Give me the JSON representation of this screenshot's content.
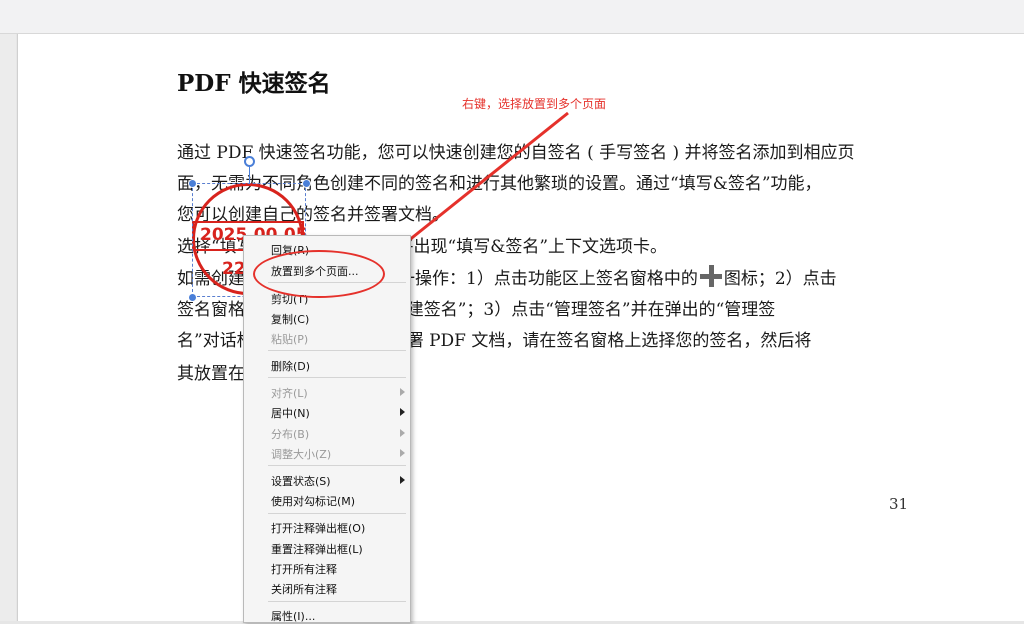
{
  "doc": {
    "title": "PDF 快速签名",
    "para1": "通过 PDF 快速签名功能，您可以快速创建您的自签名 ( 手写签名 ) 并将签名添加到相应页",
    "para2": "面，无需为不同角色创建不同的签名和进行其他繁琐的设置。通过“填写&签名”功能，",
    "para3": "您可以创建自己的签名并签署文档。",
    "para4": "选择“填写&签名”。功能区上将出现“填写&签名”上下文选项卡。",
    "para5a": "如需创建签名，请执行以下任一操作：1）点击功能区上签名窗格中的",
    "para5b": "图标；2）点击",
    "para6": "签名窗格中的签名框并选择“创建签名”；3）点击“管理签名”并在弹出的“管理签",
    "para7": "名”对话框中点击添加。如需签署 PDF 文档，请在签名窗格上选择您的签名，然后将",
    "para8": "其放置在所需位置并签名即可。",
    "page_number": "31"
  },
  "annotation": {
    "text": "右键，选择放置到多个页面",
    "color": "#e5312b"
  },
  "stamp": {
    "date": "2025.00.05",
    "sub": "22",
    "color": "#d8231d"
  },
  "context_menu": {
    "items": [
      {
        "label": "回复(R)",
        "enabled": true
      },
      {
        "label": "放置到多个页面...",
        "enabled": true
      },
      {
        "label": "剪切(T)",
        "enabled": true
      },
      {
        "label": "复制(C)",
        "enabled": true
      },
      {
        "label": "粘贴(P)",
        "enabled": false
      },
      {
        "label": "删除(D)",
        "enabled": true
      },
      {
        "label": "对齐(L)",
        "enabled": false
      },
      {
        "label": "居中(N)",
        "enabled": true
      },
      {
        "label": "分布(B)",
        "enabled": false
      },
      {
        "label": "调整大小(Z)",
        "enabled": false
      },
      {
        "label": "设置状态(S)",
        "enabled": true
      },
      {
        "label": "使用对勾标记(M)",
        "enabled": true
      },
      {
        "label": "打开注释弹出框(O)",
        "enabled": true
      },
      {
        "label": "重置注释弹出框(L)",
        "enabled": true
      },
      {
        "label": "打开所有注释",
        "enabled": true
      },
      {
        "label": "关闭所有注释",
        "enabled": true
      },
      {
        "label": "属性(I)...",
        "enabled": true
      }
    ]
  }
}
